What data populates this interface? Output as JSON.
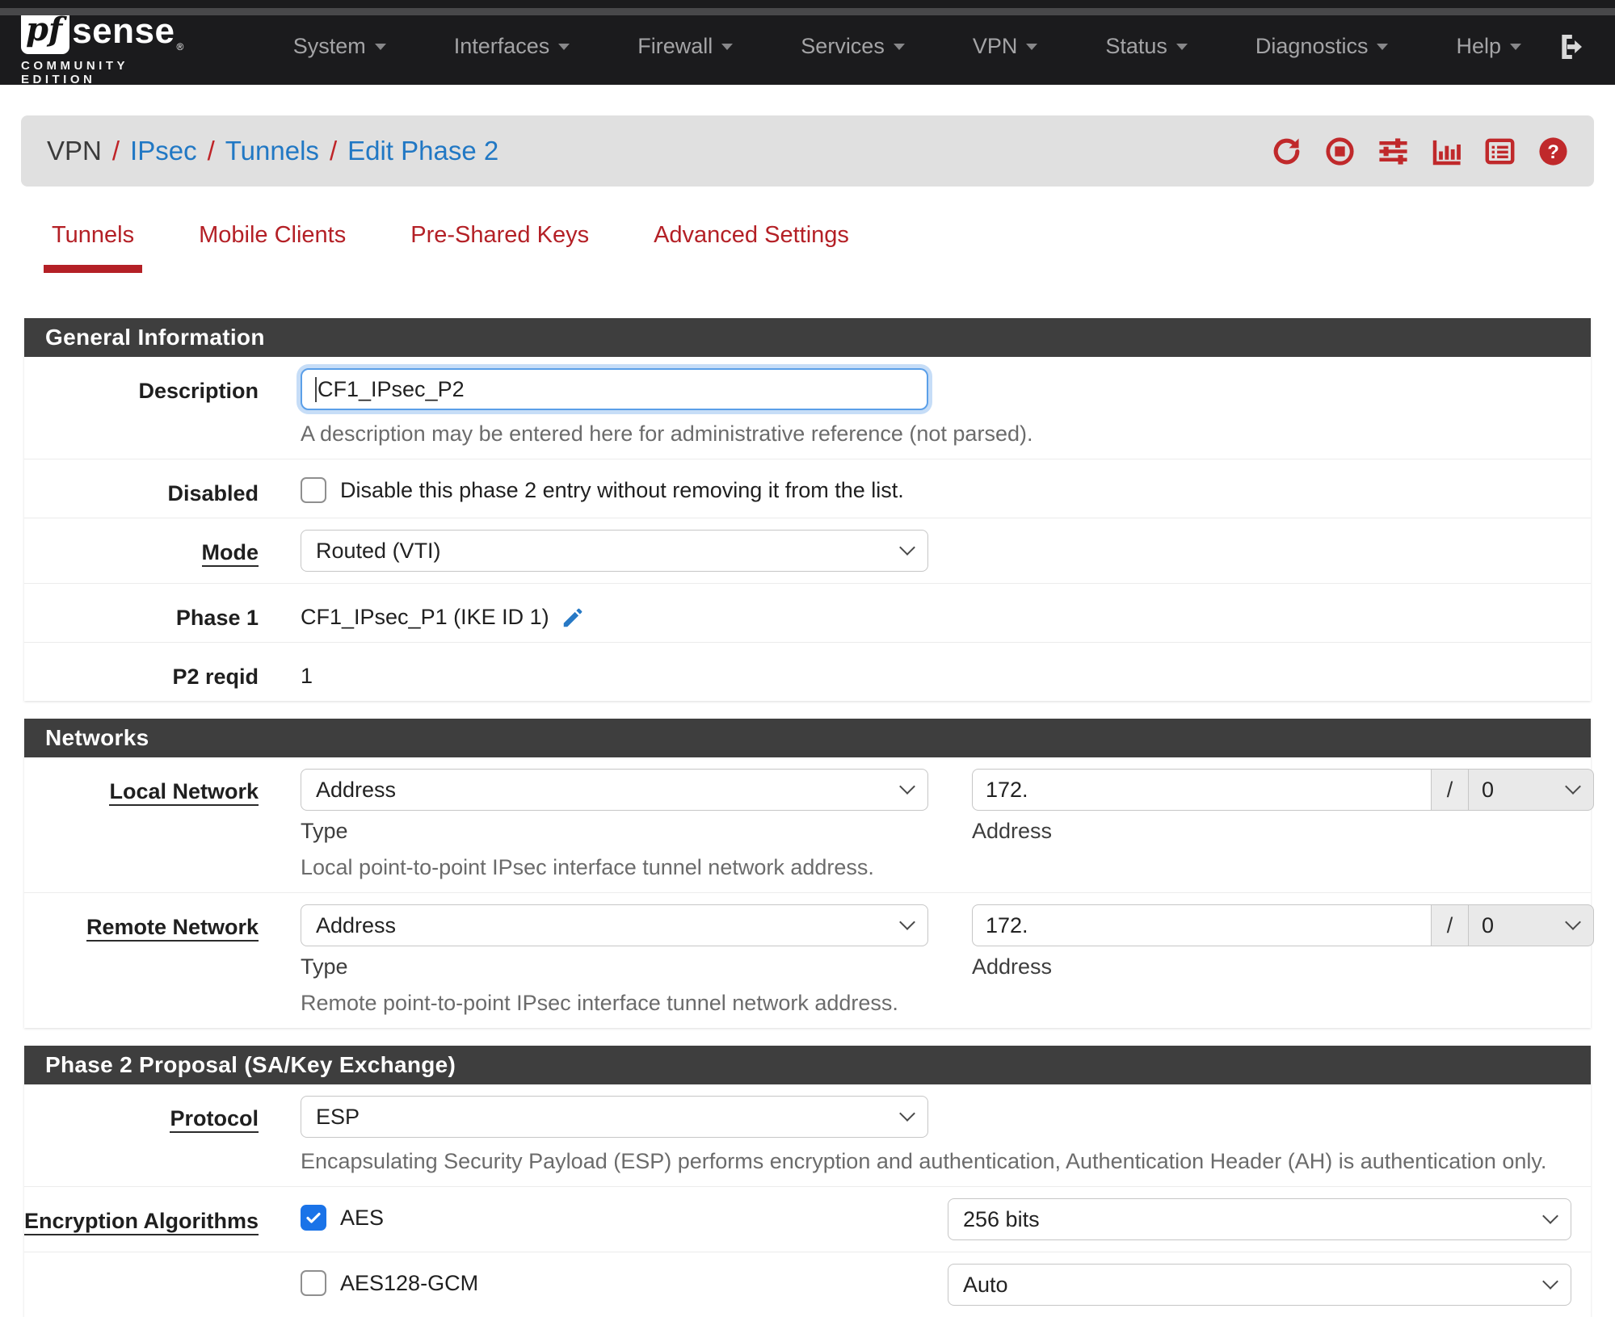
{
  "colors": {
    "navbar_bg": "#1b1b1d",
    "accent_red": "#b42026",
    "icon_red": "#c0292b",
    "link_blue": "#2178c4",
    "section_header_bg": "#3e3e3e",
    "focus_blue": "#5b9fe8",
    "checkbox_blue": "#1a73e8",
    "breadcrumb_bg": "#e0e0e0"
  },
  "navbar": {
    "logo": {
      "pf": "pf",
      "sense": "sense",
      "reg": "®",
      "edition": "COMMUNITY EDITION"
    },
    "items": [
      {
        "label": "System"
      },
      {
        "label": "Interfaces"
      },
      {
        "label": "Firewall"
      },
      {
        "label": "Services"
      },
      {
        "label": "VPN"
      },
      {
        "label": "Status"
      },
      {
        "label": "Diagnostics"
      },
      {
        "label": "Help"
      }
    ],
    "logout_icon": "sign-out-icon"
  },
  "breadcrumb": {
    "root": "VPN",
    "separator": "/",
    "links": [
      "IPsec",
      "Tunnels",
      "Edit Phase 2"
    ],
    "action_icons": [
      "refresh-icon",
      "stop-circle-icon",
      "sliders-icon",
      "chart-bar-icon",
      "list-alt-icon",
      "help-icon"
    ]
  },
  "tabs": [
    {
      "label": "Tunnels",
      "active": true
    },
    {
      "label": "Mobile Clients",
      "active": false
    },
    {
      "label": "Pre-Shared Keys",
      "active": false
    },
    {
      "label": "Advanced Settings",
      "active": false
    }
  ],
  "sections": {
    "general": {
      "title": "General Information",
      "description": {
        "label": "Description",
        "value": "CF1_IPsec_P2",
        "help": "A description may be entered here for administrative reference (not parsed)."
      },
      "disabled": {
        "label": "Disabled",
        "checkbox_label": "Disable this phase 2 entry without removing it from the list.",
        "checked": false
      },
      "mode": {
        "label": "Mode",
        "value": "Routed (VTI)"
      },
      "phase1": {
        "label": "Phase 1",
        "value": "CF1_IPsec_P1 (IKE ID 1)"
      },
      "p2reqid": {
        "label": "P2 reqid",
        "value": "1"
      }
    },
    "networks": {
      "title": "Networks",
      "local": {
        "label": "Local Network",
        "type_value": "Address",
        "type_caption": "Type",
        "address_value": "172.",
        "slash": "/",
        "mask_value": "0",
        "address_caption": "Address",
        "help": "Local point-to-point IPsec interface tunnel network address."
      },
      "remote": {
        "label": "Remote Network",
        "type_value": "Address",
        "type_caption": "Type",
        "address_value": "172.",
        "slash": "/",
        "mask_value": "0",
        "address_caption": "Address",
        "help": "Remote point-to-point IPsec interface tunnel network address."
      }
    },
    "proposal": {
      "title": "Phase 2 Proposal (SA/Key Exchange)",
      "protocol": {
        "label": "Protocol",
        "value": "ESP",
        "help": "Encapsulating Security Payload (ESP) performs encryption and authentication, Authentication Header (AH) is authentication only."
      },
      "encryption": {
        "label": "Encryption Algorithms",
        "rows": [
          {
            "name": "AES",
            "checked": true,
            "bits": "256 bits"
          },
          {
            "name": "AES128-GCM",
            "checked": false,
            "bits": "Auto"
          }
        ]
      }
    }
  }
}
